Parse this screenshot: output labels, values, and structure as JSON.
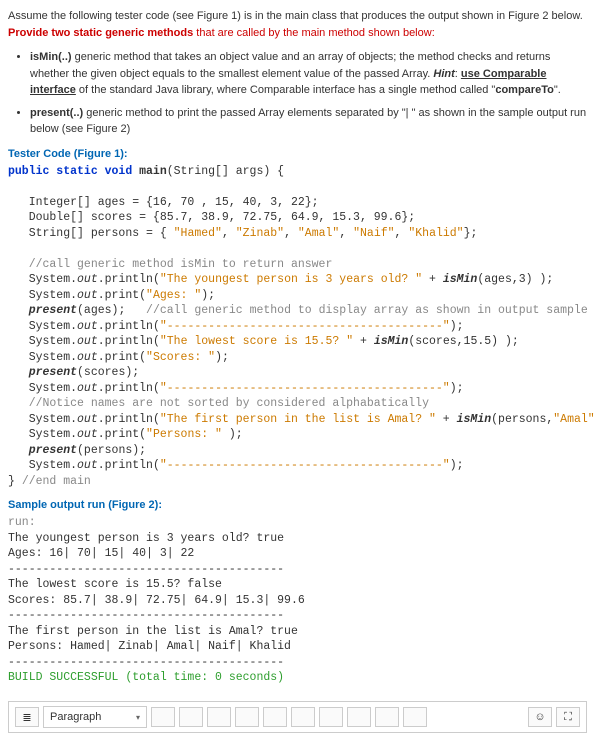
{
  "intro": {
    "lead": "Assume the following tester code (see Figure 1) is in the main class that produces the output shown in Figure 2 below. ",
    "red_part": "Provide two static generic methods",
    "tail": " that are called by the main method shown below:"
  },
  "bullets": {
    "b1_name": "isMin(..)",
    "b1_text_a": " generic method that takes an object value and an array of objects; the method checks and returns whether the given object equals to the smallest element value of the passed Array. ",
    "b1_hint": "Hint",
    "b1_text_b": ": ",
    "b1_underline": "use Comparable interface",
    "b1_text_c": " of the standard Java library, where Comparable interface has a single method called \"",
    "b1_compare": "compareTo",
    "b1_text_d": "\".",
    "b2_name": "present(..)",
    "b2_text": " generic method to print the passed Array elements separated by \"| \" as shown in the sample output run below (see Figure 2)"
  },
  "fig1_title": "Tester Code (Figure 1):",
  "code": {
    "l1a": "public static void ",
    "l1b": "main",
    "l1c": "(String[] args) {",
    "blank": "",
    "l2": "   Integer[] ages = {16, 70 , 15, 40, 3, 22};",
    "l3": "   Double[] scores = {85.7, 38.9, 72.75, 64.9, 15.3, 99.6};",
    "l4a": "   String[] persons = { ",
    "l4b": "\"Hamed\"",
    "l4c": ", ",
    "l4d": "\"Zinab\"",
    "l4e": ", ",
    "l4f": "\"Amal\"",
    "l4g": ", ",
    "l4h": "\"Naif\"",
    "l4i": ", ",
    "l4j": "\"Khalid\"",
    "l4k": "};",
    "l5": "   //call generic method isMin to return answer",
    "l6a": "   System.",
    "l6b": "out",
    "l6c": ".println(",
    "l6d": "\"The youngest person is 3 years old? \"",
    "l6e": " + ",
    "l6f": "isMin",
    "l6g": "(ages,3) );",
    "l7a": "   System.",
    "l7b": "out",
    "l7c": ".print(",
    "l7d": "\"Ages: \"",
    "l7e": ");",
    "l8a": "   ",
    "l8b": "present",
    "l8c": "(ages);   ",
    "l8d": "//call generic method to display array as shown in output sample",
    "l9a": "   System.",
    "l9b": "out",
    "l9c": ".println(",
    "l9d": "\"----------------------------------------\"",
    "l9e": ");",
    "l10a": "   System.",
    "l10b": "out",
    "l10c": ".println(",
    "l10d": "\"The lowest score is 15.5? \"",
    "l10e": " + ",
    "l10f": "isMin",
    "l10g": "(scores,15.5) );",
    "l11a": "   System.",
    "l11b": "out",
    "l11c": ".print(",
    "l11d": "\"Scores: \"",
    "l11e": ");",
    "l12a": "   ",
    "l12b": "present",
    "l12c": "(scores);",
    "l13a": "   System.",
    "l13b": "out",
    "l13c": ".println(",
    "l13d": "\"----------------------------------------\"",
    "l13e": ");",
    "l14": "   //Notice names are not sorted by considered alphabatically",
    "l15a": "   System.",
    "l15b": "out",
    "l15c": ".println(",
    "l15d": "\"The first person in the list is Amal? \"",
    "l15e": " + ",
    "l15f": "isMin",
    "l15g": "(persons,",
    "l15h": "\"Amal\"",
    "l15i": ")",
    "l16a": "   System.",
    "l16b": "out",
    "l16c": ".print(",
    "l16d": "\"Persons: \"",
    "l16e": " );",
    "l17a": "   ",
    "l17b": "present",
    "l17c": "(persons);",
    "l18a": "   System.",
    "l18b": "out",
    "l18c": ".println(",
    "l18d": "\"----------------------------------------\"",
    "l18e": ");",
    "l19a": "} ",
    "l19b": "//end main"
  },
  "fig2_title": "Sample output run (Figure 2):",
  "output": {
    "o1": "run:",
    "o2": "The youngest person is 3 years old? true",
    "o3": "Ages: 16| 70| 15| 40| 3| 22",
    "o4": "----------------------------------------",
    "o5": "The lowest score is 15.5? false",
    "o6": "Scores: 85.7| 38.9| 72.75| 64.9| 15.3| 99.6",
    "o7": "----------------------------------------",
    "o8": "The first person in the list is Amal? true",
    "o9": "Persons: Hamed| Zinab| Amal| Naif| Khalid",
    "o10": "----------------------------------------",
    "o11": "BUILD SUCCESSFUL (total time: 0 seconds)"
  },
  "toolbar": {
    "paragraph": "Paragraph",
    "menu_icon": "≣",
    "smile": "☺",
    "expand": "⛶"
  }
}
